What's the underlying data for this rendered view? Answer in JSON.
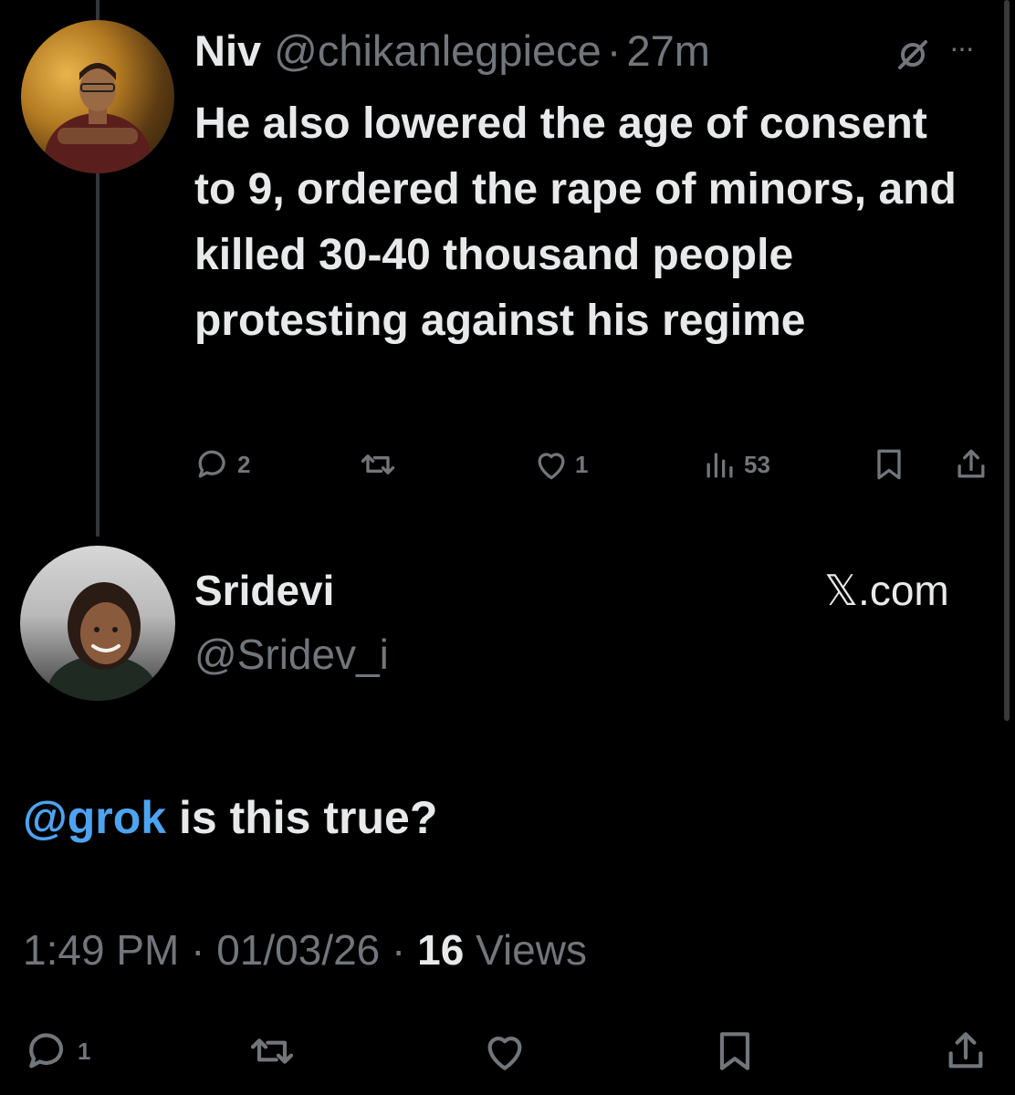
{
  "tweet_reply": {
    "author_name": "Niv",
    "author_handle": "@chikanlegpiece",
    "separator": "·",
    "time_ago": "27m",
    "more_label": "···",
    "text": "He also lowered the age of consent to 9, ordered the rape of minors, and killed 30-40 thousand people protesting against his regime",
    "replies": "2",
    "reposts": "",
    "likes": "1",
    "views": "53"
  },
  "tweet_main": {
    "author_name": "Sridevi",
    "author_handle": "@Sridev_i",
    "source_label": "𝕏.com",
    "mention": "@grok",
    "text_rest": " is this true?",
    "time": "1:49 PM",
    "separator": "·",
    "date": "01/03/26",
    "views_count": "16",
    "views_label": "Views",
    "replies": "1"
  },
  "colors": {
    "background": "#000000",
    "primary_text": "#e7e9ea",
    "secondary_text": "#71767b",
    "accent": "#4da3f0"
  }
}
